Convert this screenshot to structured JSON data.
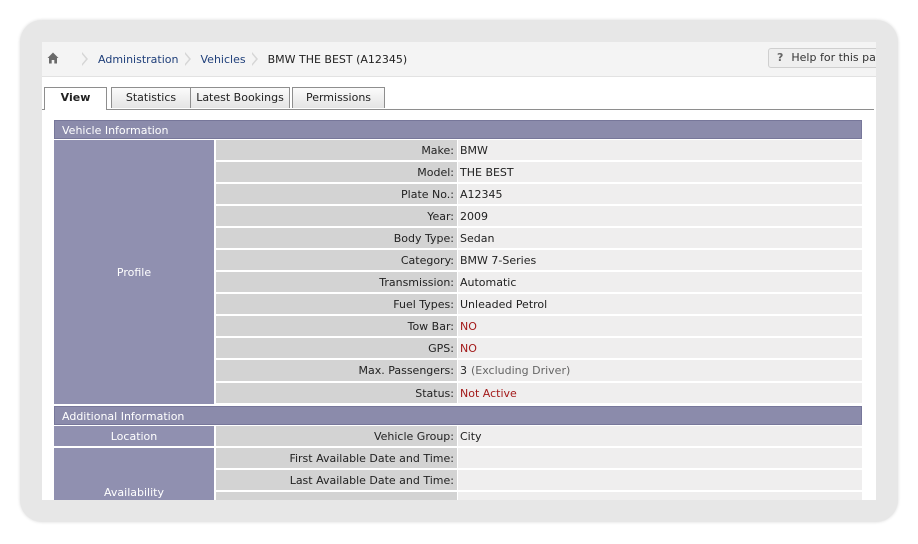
{
  "breadcrumb": {
    "items": [
      "Administration",
      "Vehicles"
    ],
    "current": "BMW THE BEST (A12345)"
  },
  "help": {
    "label": "Help for this page",
    "icon": "?"
  },
  "tabs": [
    {
      "label": "View",
      "active": true
    },
    {
      "label": "Statistics"
    },
    {
      "label": "Latest Bookings"
    },
    {
      "label": "Permissions"
    }
  ],
  "vehicle_info": {
    "title": "Vehicle Information",
    "group": "Profile",
    "rows": [
      {
        "label": "Make:",
        "value": "BMW"
      },
      {
        "label": "Model:",
        "value": "THE BEST"
      },
      {
        "label": "Plate No.:",
        "value": "A12345"
      },
      {
        "label": "Year:",
        "value": "2009"
      },
      {
        "label": "Body Type:",
        "value": "Sedan"
      },
      {
        "label": "Category:",
        "value": "BMW 7-Series"
      },
      {
        "label": "Transmission:",
        "value": "Automatic"
      },
      {
        "label": "Fuel Types:",
        "value": "Unleaded Petrol"
      },
      {
        "label": "Tow Bar:",
        "value": "NO"
      },
      {
        "label": "GPS:",
        "value": "NO"
      },
      {
        "label": "Max. Passengers:",
        "value": "3",
        "note": "(Excluding Driver)"
      },
      {
        "label": "Status:",
        "value": "Not Active"
      }
    ]
  },
  "additional_info": {
    "title": "Additional Information",
    "location": {
      "group": "Location",
      "label": "Vehicle Group:",
      "value": "City"
    },
    "availability": {
      "group": "Availability",
      "rows": [
        {
          "label": "First Available Date and Time:",
          "value": ""
        },
        {
          "label": "Last Available Date and Time:",
          "value": ""
        }
      ]
    }
  },
  "colors": {
    "section_header": "#8b8bab",
    "row_header": "#9090b0",
    "label_bg": "#d3d3d3",
    "value_bg": "#efeeee",
    "alert_red": "#a31a1a",
    "link_blue": "#1f3f7a"
  }
}
